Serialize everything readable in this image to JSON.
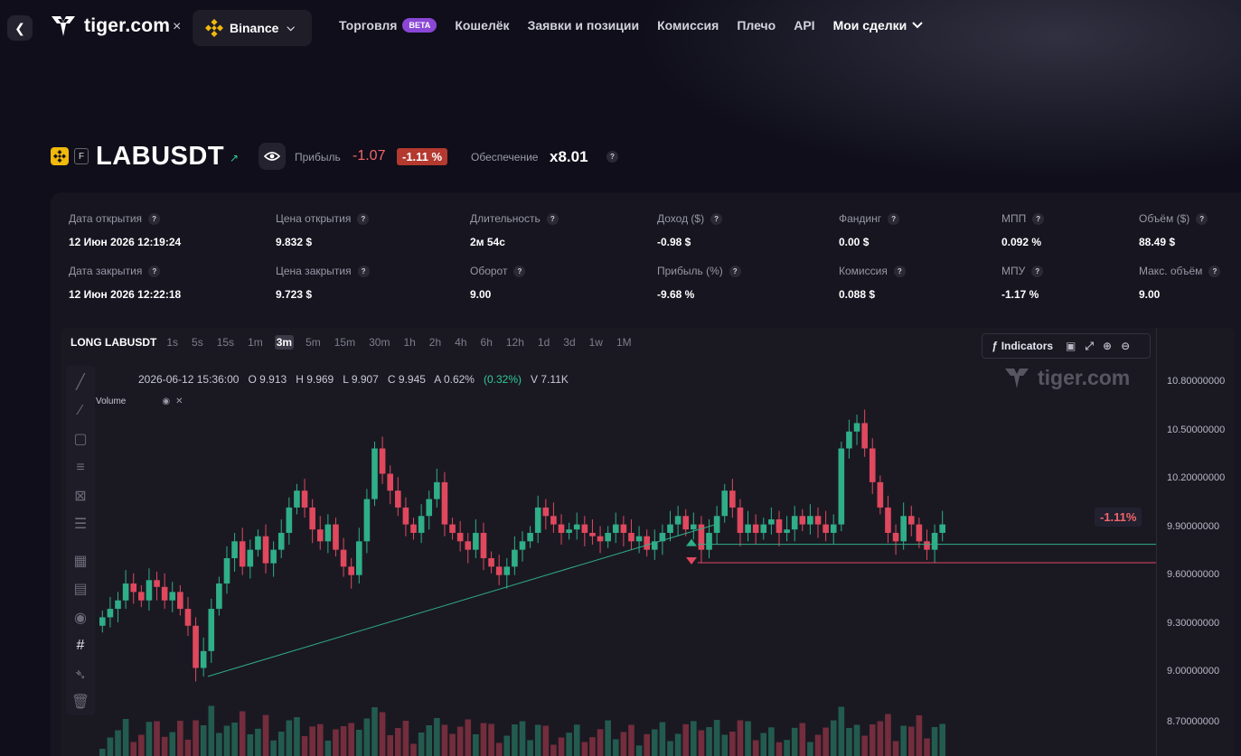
{
  "nav": {
    "brand": "tiger.com",
    "separator": "×",
    "exchange": "Binance",
    "items": [
      {
        "label": "Торговля",
        "badge": "BETA"
      },
      {
        "label": "Кошелёк"
      },
      {
        "label": "Заявки и позиции"
      },
      {
        "label": "Комиссия"
      },
      {
        "label": "Плечо"
      },
      {
        "label": "API"
      },
      {
        "label": "Мои сделки",
        "active": true
      }
    ]
  },
  "symbol": {
    "futures_badge": "F",
    "name": "LABUSDT",
    "profit_label": "Прибыль",
    "profit_value": "-1.07",
    "profit_percent": "-1.11 %",
    "collateral_label": "Обеспечение",
    "collateral_value": "x8.01"
  },
  "stats": [
    {
      "label": "Дата открытия",
      "value": "12 Июн 2026 12:19:24"
    },
    {
      "label": "Цена открытия",
      "value": "9.832 $"
    },
    {
      "label": "Длительность",
      "value": "2м 54с"
    },
    {
      "label": "Доход ($)",
      "value": "-0.98 $"
    },
    {
      "label": "Фандинг",
      "value": "0.00 $"
    },
    {
      "label": "МПП",
      "value": "0.092 %"
    },
    {
      "label": "Объём ($)",
      "value": "88.49 $"
    },
    {
      "label": "Дата закрытия",
      "value": "12 Июн 2026 12:22:18"
    },
    {
      "label": "Цена закрытия",
      "value": "9.723 $"
    },
    {
      "label": "Оборот",
      "value": "9.00"
    },
    {
      "label": "Прибыль (%)",
      "value": "-9.68 %"
    },
    {
      "label": "Комиссия",
      "value": "0.088 $"
    },
    {
      "label": "МПУ",
      "value": "-1.17 %"
    },
    {
      "label": "Макс. объём",
      "value": "9.00"
    }
  ],
  "chart": {
    "title": "LONG LABUSDT",
    "timeframes": [
      "1s",
      "5s",
      "15s",
      "1m",
      "3m",
      "5m",
      "15m",
      "30m",
      "1h",
      "2h",
      "4h",
      "6h",
      "12h",
      "1d",
      "3d",
      "1w",
      "1M"
    ],
    "selected_timeframe": "3m",
    "indicators_label": "Indicators",
    "ohlc": {
      "time": "2026-06-12 15:36:00",
      "o_label": "O",
      "o": "9.913",
      "h_label": "H",
      "h": "9.969",
      "l_label": "L",
      "l": "9.907",
      "c_label": "C",
      "c": "9.945",
      "a_label": "A",
      "a": "0.62%",
      "a_abs": "(0.32%)",
      "v_label": "V",
      "v": "7.11K"
    },
    "volume_label": "Volume",
    "watermark": "tiger.com",
    "pnl_tag": "-1.11%",
    "price_ticks": [
      "10.80000000",
      "10.50000000",
      "10.20000000",
      "9.90000000",
      "9.60000000",
      "9.30000000",
      "9.00000000",
      "8.70000000"
    ],
    "colors": {
      "up": "#2fae88",
      "down": "#e0485e",
      "accent": "#f3666a"
    }
  },
  "chart_data": {
    "type": "candlestick",
    "title": "LONG LABUSDT",
    "timeframe": "3m",
    "ylim": [
      8.6,
      10.9
    ],
    "entry_price": 9.832,
    "exit_price": 9.723,
    "close_series": [
      9.4,
      9.45,
      9.5,
      9.6,
      9.55,
      9.5,
      9.62,
      9.58,
      9.5,
      9.55,
      9.45,
      9.35,
      9.1,
      9.2,
      9.45,
      9.6,
      9.75,
      9.85,
      9.7,
      9.8,
      9.88,
      9.72,
      9.8,
      9.9,
      10.05,
      10.15,
      10.05,
      9.92,
      9.85,
      9.95,
      9.8,
      9.7,
      9.65,
      9.85,
      10.1,
      10.4,
      10.25,
      10.15,
      10.05,
      9.95,
      9.9,
      10.0,
      10.1,
      10.2,
      9.95,
      9.9,
      9.85,
      9.8,
      9.9,
      9.75,
      9.7,
      9.65,
      9.7,
      9.8,
      9.85,
      9.9,
      10.05,
      10.0,
      9.95,
      9.9,
      9.92,
      9.95,
      9.9,
      9.88,
      9.85,
      9.9,
      9.95,
      9.9,
      9.85,
      9.88,
      9.8,
      9.85,
      9.9,
      9.95,
      10.0,
      9.92,
      9.95,
      9.8,
      9.9,
      10.0,
      10.15,
      10.05,
      9.9,
      9.95,
      9.9,
      9.95,
      9.98,
      9.9,
      9.92,
      10.0,
      9.95,
      10.0,
      9.95,
      9.9,
      9.95,
      10.4,
      10.5,
      10.55,
      10.4,
      10.2,
      10.05,
      9.9,
      9.85,
      10.0,
      9.95,
      9.85,
      9.8,
      9.9,
      9.95
    ]
  }
}
